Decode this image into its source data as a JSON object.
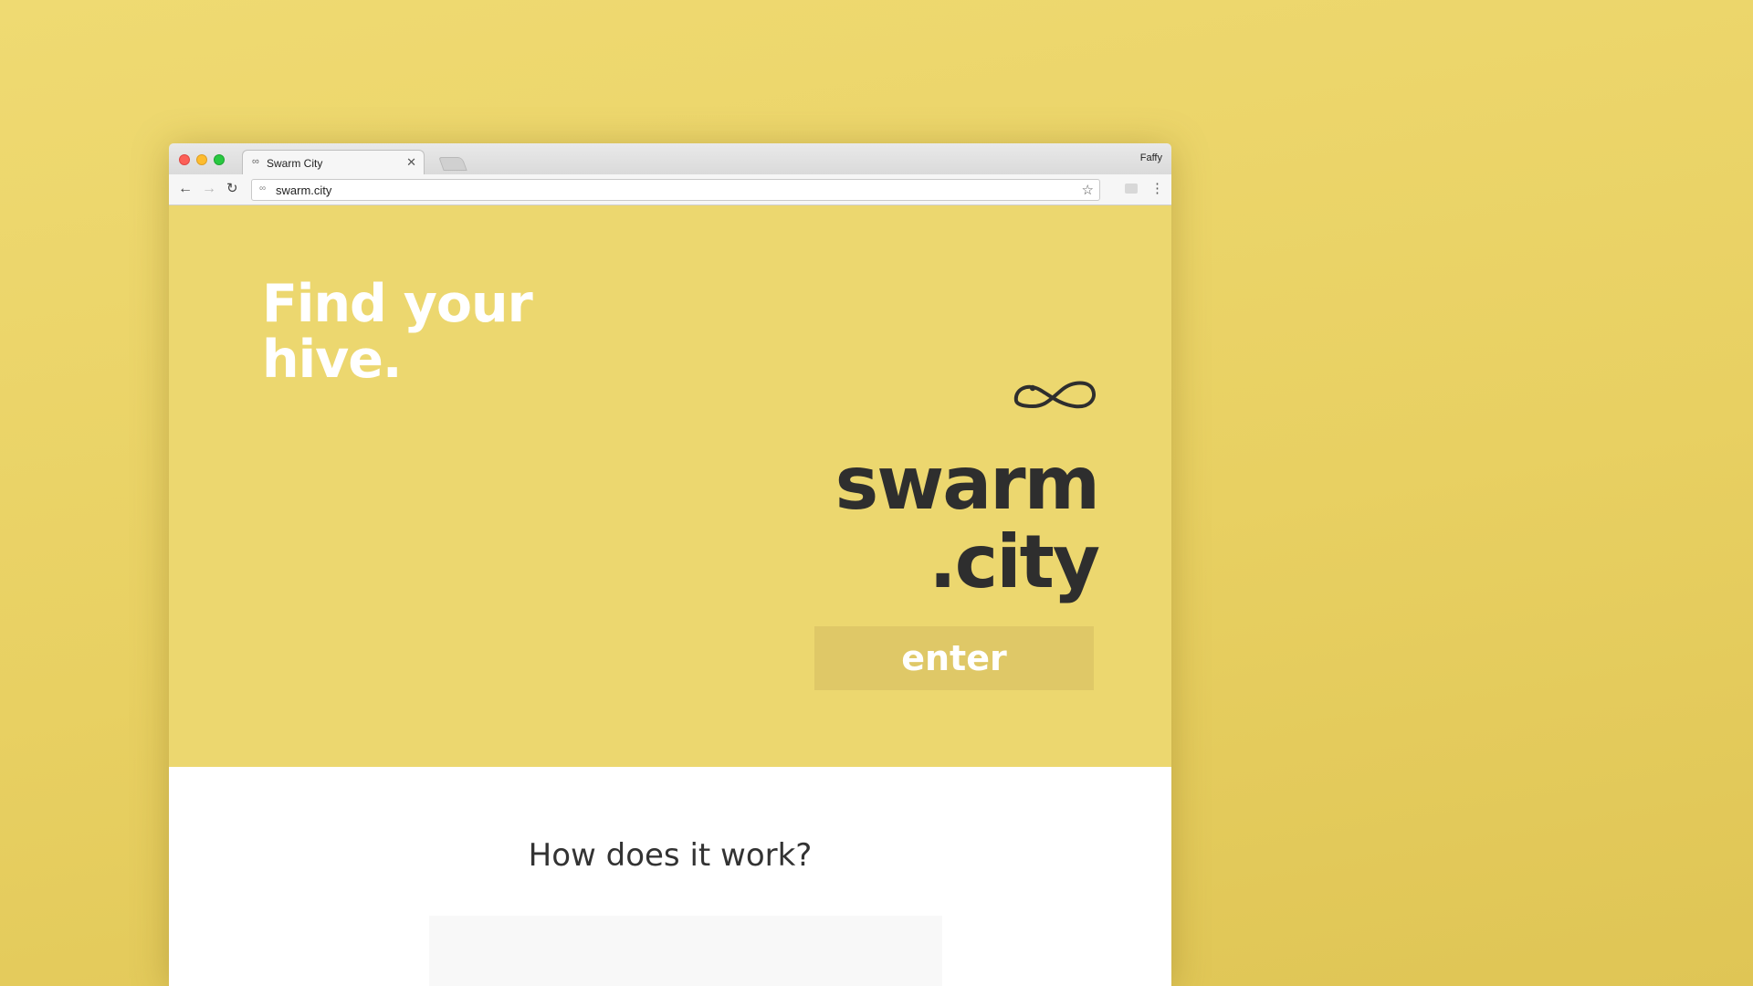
{
  "browser": {
    "tab": {
      "favicon": "swarm-city-favicon",
      "title": "Swarm City"
    },
    "profile_name": "Faffy",
    "address_bar": {
      "icon": "swarm-city-favicon",
      "url": "swarm.city"
    },
    "icons": {
      "back": "back-arrow-icon",
      "forward": "forward-arrow-icon",
      "reload": "reload-icon",
      "bookmark": "star-icon",
      "extension": "extension-icon",
      "menu": "more-vertical-icon",
      "tab_close": "close-icon"
    }
  },
  "hero": {
    "tagline": [
      "Find your",
      "hive."
    ],
    "logo_icon": "infinity-logo-icon",
    "brand": [
      "swarm",
      ".city"
    ],
    "enter_label": "enter",
    "colors": {
      "background": "#ecd76f",
      "button": "#dfc867",
      "brand_text": "#2e2e2e",
      "tagline_text": "#ffffff"
    }
  },
  "content": {
    "heading": "How does it work?"
  },
  "colors": {
    "desktop_background": "#e8d062"
  }
}
